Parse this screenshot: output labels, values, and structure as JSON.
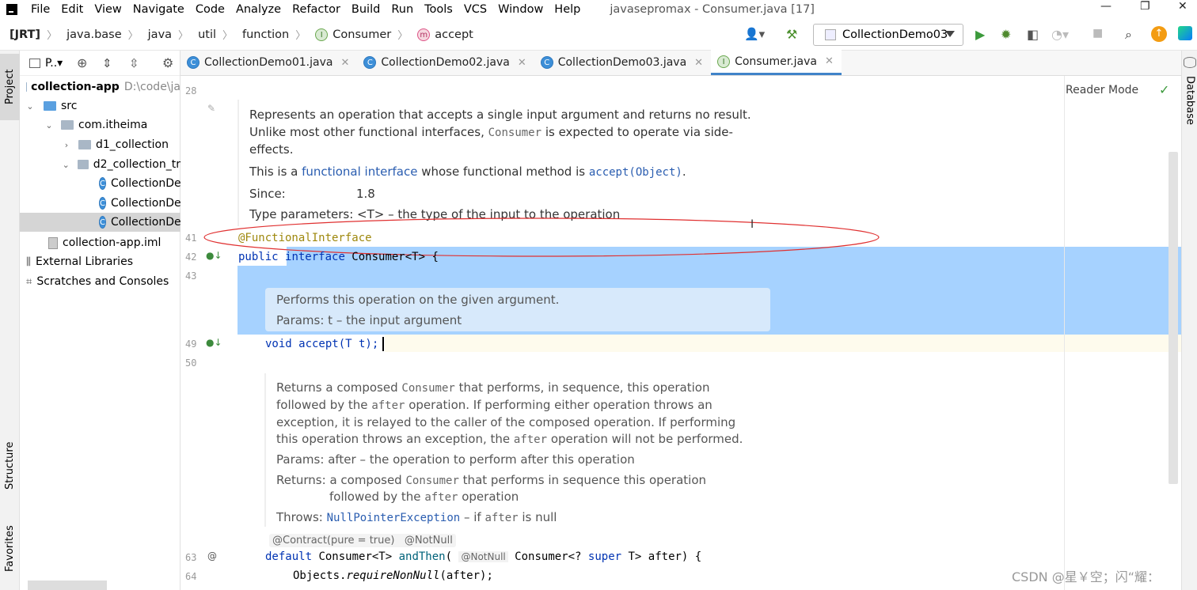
{
  "menubar": {
    "items": [
      "File",
      "Edit",
      "View",
      "Navigate",
      "Code",
      "Analyze",
      "Refactor",
      "Build",
      "Run",
      "Tools",
      "VCS",
      "Window",
      "Help"
    ],
    "title": "javasepromax - Consumer.java [17]"
  },
  "navbar": {
    "breadcrumbs": [
      "[JRT]",
      "java.base",
      "java",
      "util",
      "function",
      "Consumer",
      "accept"
    ],
    "run_config": "CollectionDemo03"
  },
  "left_tabs": {
    "project": "Project",
    "structure": "Structure",
    "favorites": "Favorites"
  },
  "right_tabs": {
    "database": "Database"
  },
  "project_panel": {
    "header": "P..▾",
    "tree": [
      {
        "label": "collection-app",
        "suffix": "D:\\code\\ja"
      },
      {
        "label": "src"
      },
      {
        "label": "com.itheima"
      },
      {
        "label": "d1_collection"
      },
      {
        "label": "d2_collection_tr"
      },
      {
        "label": "CollectionDe"
      },
      {
        "label": "CollectionDe"
      },
      {
        "label": "CollectionDe"
      },
      {
        "label": "collection-app.iml"
      },
      {
        "label": "External Libraries"
      },
      {
        "label": "Scratches and Consoles"
      }
    ]
  },
  "tabs": [
    "CollectionDemo01.java",
    "CollectionDemo02.java",
    "CollectionDemo03.java",
    "Consumer.java"
  ],
  "editor": {
    "reader_mode": "Reader Mode",
    "line_numbers": {
      "l28": "28",
      "l41": "41",
      "l42": "42",
      "l43": "43",
      "l49": "49",
      "l50": "50",
      "l63": "63",
      "l64": "64"
    },
    "doc1": {
      "line1": "Represents an operation that accepts a single input argument and returns no result.",
      "line2a": "Unlike most other functional interfaces, ",
      "line2m": "Consumer",
      "line2b": " is expected to operate via side-",
      "line3": "effects.",
      "line4a": "This is a ",
      "line4link": "functional interface",
      "line4b": " whose functional method is ",
      "line4m": "accept(Object)",
      "line4c": ".",
      "since_label": "Since:",
      "since_value": "1.8",
      "type_params": "Type parameters: <T> – the type of the input to the operation"
    },
    "annotation": "@FunctionalInterface",
    "decl": {
      "kw1": "public",
      "kw2": "interface",
      "rest": " Consumer<T> {"
    },
    "doc2": {
      "line1": "Performs this operation on the given argument.",
      "line2": "Params: t – the input argument"
    },
    "method": {
      "kw": "void",
      "rest": " accept(T t);"
    },
    "doc3": {
      "l1a": "Returns a composed ",
      "l1m": "Consumer",
      "l1b": " that performs, in sequence, this operation",
      "l2a": "followed by the ",
      "l2m": "after",
      "l2b": " operation. If performing either operation throws an",
      "l3": "exception, it is relayed to the caller of the composed operation. If performing",
      "l4a": "this operation throws an exception, the ",
      "l4m": "after",
      "l4b": " operation will not be performed.",
      "params_label": "Params:",
      "params_value": "after – the operation to perform after this operation",
      "returns_label": "Returns:",
      "returns_a": "a composed ",
      "returns_m": "Consumer",
      "returns_b": " that performs in sequence this operation",
      "returns2a": "followed by the ",
      "returns2m": "after",
      "returns2b": " operation",
      "throws_label": "Throws:",
      "throws_link": "NullPointerException",
      "throws_a": " – if ",
      "throws_m": "after",
      "throws_b": " is null"
    },
    "hints": "@Contract(pure = true)   @NotNull",
    "line63": {
      "kw": "default",
      "a": " Consumer<T> ",
      "m": "andThen",
      "b": "( ",
      "hint": "@NotNull",
      "c": " Consumer<? ",
      "kw2": "super",
      "d": " T> after) {"
    },
    "line64": {
      "a": "Objects.",
      "m": "requireNonNull",
      "b": "(after);"
    }
  },
  "watermark": "CSDN @星￥空；闪“耀："
}
